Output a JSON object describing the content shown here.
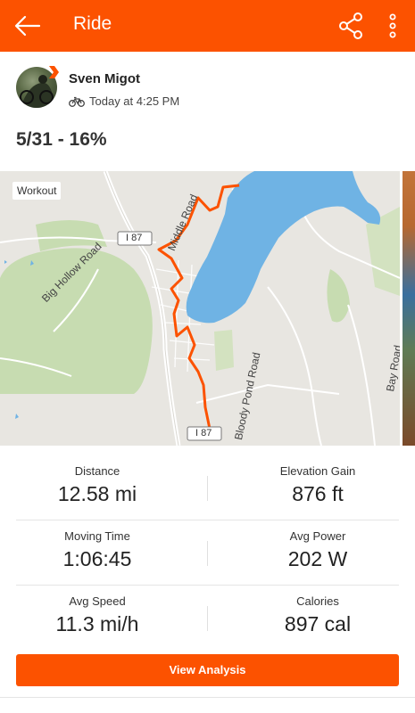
{
  "header": {
    "title": "Ride",
    "back_icon": "arrow-left-icon",
    "share_icon": "share-icon",
    "more_icon": "more-vert-icon",
    "bg_color": "#fc5200"
  },
  "athlete": {
    "name": "Sven Migot",
    "time": "Today at 4:25 PM",
    "activity_icon": "bike-icon"
  },
  "activity": {
    "title": "5/31 - 16%"
  },
  "map": {
    "tag": "Workout",
    "labels": {
      "middle_road": "Middle Road",
      "i87_top": "I 87",
      "i87_bottom": "I 87",
      "big_hollow_road": "Big Hollow Road",
      "bloody_pond_road": "Bloody Pond Road",
      "bay_road": "Bay Road"
    },
    "route_color": "#fc5200",
    "water_color": "#6fb3e4",
    "park_color": "#c7dcb1"
  },
  "stats": {
    "distance": {
      "label": "Distance",
      "value": "12.58 mi"
    },
    "elevation": {
      "label": "Elevation Gain",
      "value": "876 ft"
    },
    "moving_time": {
      "label": "Moving Time",
      "value": "1:06:45"
    },
    "avg_power": {
      "label": "Avg Power",
      "value": "202 W"
    },
    "avg_speed": {
      "label": "Avg Speed",
      "value": "11.3 mi/h"
    },
    "calories": {
      "label": "Calories",
      "value": "897 cal"
    }
  },
  "cta": {
    "label": "View Analysis"
  }
}
